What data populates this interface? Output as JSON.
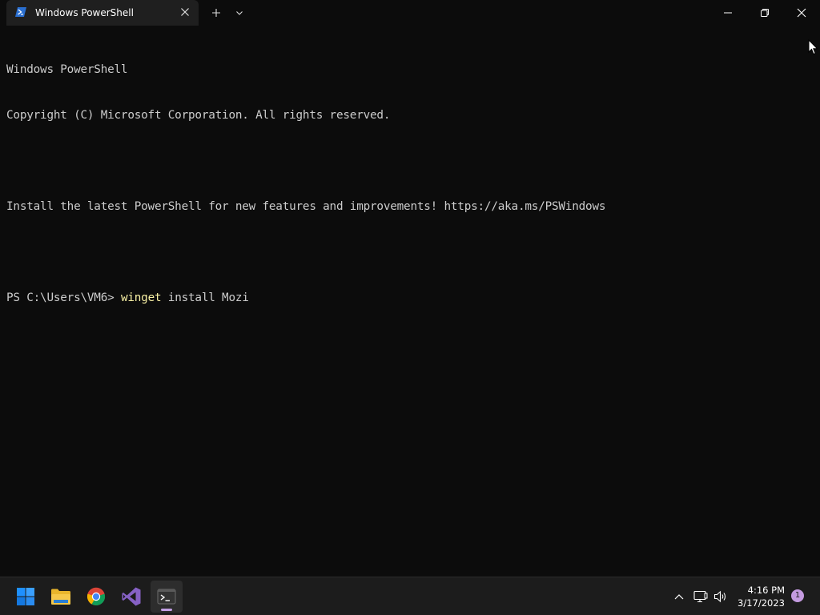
{
  "tab": {
    "title": "Windows PowerShell",
    "icon": "powershell-icon"
  },
  "titlebar": {
    "new_tab_icon": "plus-icon",
    "dropdown_icon": "chevron-down-icon",
    "minimize_icon": "minimize-icon",
    "restore_icon": "restore-icon",
    "close_icon": "close-icon"
  },
  "terminal": {
    "lines": [
      "Windows PowerShell",
      "Copyright (C) Microsoft Corporation. All rights reserved.",
      "",
      "Install the latest PowerShell for new features and improvements! https://aka.ms/PSWindows",
      ""
    ],
    "prompt": "PS C:\\Users\\VM6> ",
    "command": "winget",
    "args": " install Mozi",
    "text_color": "#cccccc",
    "command_color": "#f9f1a5",
    "background": "#0c0c0c"
  },
  "taskbar": {
    "apps": [
      {
        "name": "start-icon"
      },
      {
        "name": "file-explorer-icon"
      },
      {
        "name": "chrome-icon"
      },
      {
        "name": "visual-studio-icon"
      },
      {
        "name": "terminal-icon",
        "active": true
      }
    ],
    "tray": {
      "icons": [
        "chevron-up-icon",
        "network-icon",
        "volume-icon"
      ],
      "time": "4:16 PM",
      "date": "3/17/2023",
      "notification_count": "1"
    }
  }
}
